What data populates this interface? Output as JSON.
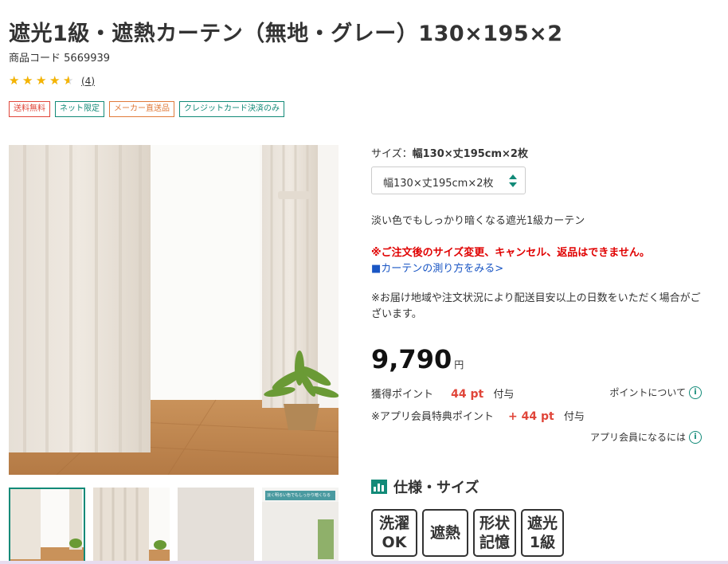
{
  "product": {
    "title": "遮光1級・遮熱カーテン（無地・グレー）130×195×2",
    "code_label": "商品コード",
    "code_value": "5669939",
    "rating": 4.5,
    "review_count": "(4)"
  },
  "tags": [
    {
      "label": "送料無料",
      "color": "#e0463a"
    },
    {
      "label": "ネット限定",
      "color": "#128a78"
    },
    {
      "label": "メーカー直送品",
      "color": "#e07a3a"
    },
    {
      "label": "クレジットカード決済のみ",
      "color": "#128a78"
    }
  ],
  "size": {
    "label": "サイズ：",
    "value": "幅130×丈195cm×2枚",
    "selected": "幅130×丈195cm×2枚"
  },
  "description": "淡い色でもしっかり暗くなる遮光1級カーテン",
  "warning": "※ご注文後のサイズ変更、キャンセル、返品はできません。",
  "measure_link": "■カーテンの測り方をみる>",
  "note": "※お届け地域や注文状況により配送目安以上の日数をいただく場合がございます。",
  "price": {
    "value": "9,790",
    "unit": "円"
  },
  "points": {
    "label": "獲得ポイント",
    "value": "44 pt",
    "suffix": "付与",
    "info_link": "ポイントについて",
    "app_label": "※アプリ会員特典ポイント",
    "app_value": "+ 44 pt",
    "app_suffix": "付与",
    "app_link": "アプリ会員になるには"
  },
  "spec": {
    "title": "仕様・サイズ",
    "badges": [
      {
        "line1": "洗濯",
        "line2": "OK"
      },
      {
        "line1": "遮熱",
        "line2": ""
      },
      {
        "line1": "形状",
        "line2": "記憶"
      },
      {
        "line1": "遮光",
        "line2": "1級"
      }
    ]
  },
  "thumbnail_caption": "淡く明るい色でもしっかり暗くなる",
  "colors": {
    "accent": "#128a78",
    "price_red": "#e0463a",
    "warn_red": "#e00000",
    "link_blue": "#1a56c4"
  }
}
